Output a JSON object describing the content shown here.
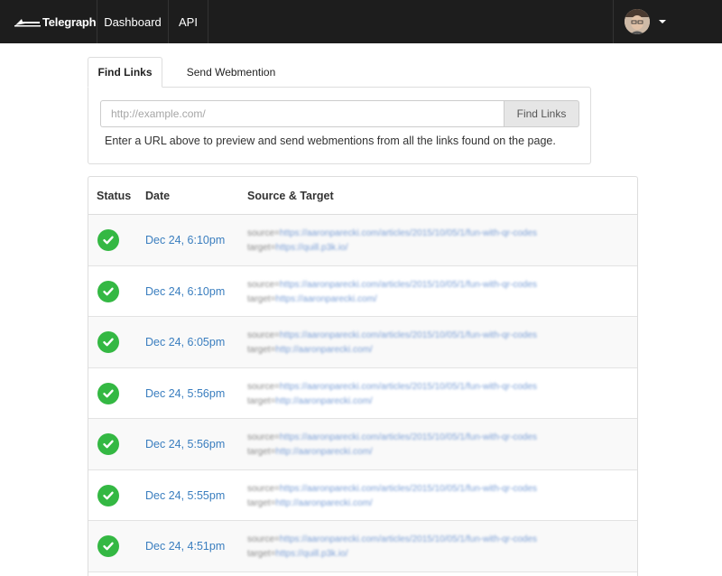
{
  "navbar": {
    "brand": "Telegraph",
    "links": [
      {
        "label": "Dashboard"
      },
      {
        "label": "API"
      }
    ]
  },
  "tabs": [
    {
      "label": "Find Links",
      "active": true
    },
    {
      "label": "Send Webmention",
      "active": false
    }
  ],
  "find": {
    "placeholder": "http://example.com/",
    "button": "Find Links",
    "help": "Enter a URL above to preview and send webmentions from all the links found on the page."
  },
  "table": {
    "headers": {
      "status": "Status",
      "date": "Date",
      "source": "Source & Target"
    },
    "rows": [
      {
        "status": "success",
        "date": "Dec 24, 6:10pm",
        "source_label": "source=",
        "source": "https://aaronparecki.com/articles/2015/10/05/1/fun-with-qr-codes",
        "target_label": "target=",
        "target": "https://quill.p3k.io/"
      },
      {
        "status": "success",
        "date": "Dec 24, 6:10pm",
        "source_label": "source=",
        "source": "https://aaronparecki.com/articles/2015/10/05/1/fun-with-qr-codes",
        "target_label": "target=",
        "target": "https://aaronparecki.com/"
      },
      {
        "status": "success",
        "date": "Dec 24, 6:05pm",
        "source_label": "source=",
        "source": "https://aaronparecki.com/articles/2015/10/05/1/fun-with-qr-codes",
        "target_label": "target=",
        "target": "http://aaronparecki.com/"
      },
      {
        "status": "success",
        "date": "Dec 24, 5:56pm",
        "source_label": "source=",
        "source": "https://aaronparecki.com/articles/2015/10/05/1/fun-with-qr-codes",
        "target_label": "target=",
        "target": "http://aaronparecki.com/"
      },
      {
        "status": "success",
        "date": "Dec 24, 5:56pm",
        "source_label": "source=",
        "source": "https://aaronparecki.com/articles/2015/10/05/1/fun-with-qr-codes",
        "target_label": "target=",
        "target": "http://aaronparecki.com/"
      },
      {
        "status": "success",
        "date": "Dec 24, 5:55pm",
        "source_label": "source=",
        "source": "https://aaronparecki.com/articles/2015/10/05/1/fun-with-qr-codes",
        "target_label": "target=",
        "target": "http://aaronparecki.com/"
      },
      {
        "status": "success",
        "date": "Dec 24, 4:51pm",
        "source_label": "source=",
        "source": "https://aaronparecki.com/articles/2015/10/05/1/fun-with-qr-codes",
        "target_label": "target=",
        "target": "https://quill.p3k.io/"
      }
    ]
  },
  "colors": {
    "navbar": "#1d1d1d",
    "link": "#3a7ebf",
    "success": "#34b843"
  }
}
